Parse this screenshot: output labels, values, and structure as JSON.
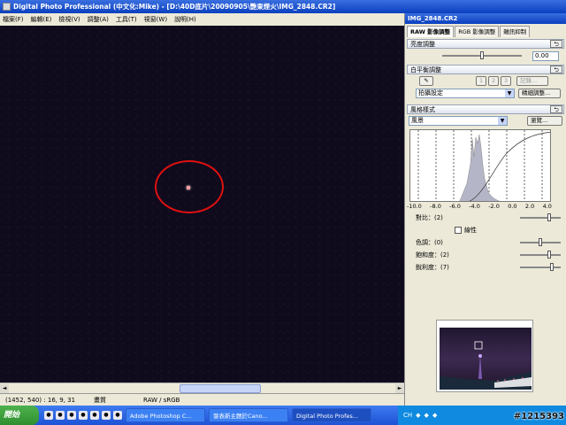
{
  "window": {
    "title": "Digital Photo Professional (中文化:Mike) - [D:\\40D底片\\20090905\\艷東煙火\\IMG_2848.CR2]"
  },
  "menu": [
    "檔案(F)",
    "編輯(E)",
    "檢視(V)",
    "調整(A)",
    "工具(T)",
    "視窗(W)",
    "說明(H)"
  ],
  "status": {
    "coords": "(1452, 540) : 16, 9, 31",
    "quality": "畫質",
    "format": "RAW / sRGB"
  },
  "panel": {
    "title": "IMG_2848.CR2",
    "tabs": [
      "RAW 影像調整",
      "RGB 影像調整",
      "雜訊抑制"
    ],
    "brightness": {
      "header": "亮度調整",
      "value": "0.00",
      "level": 0.5
    },
    "white_balance": {
      "header": "白平衡調整",
      "presets": [
        "1",
        "2",
        "3"
      ],
      "register_label": "記錄...",
      "mode": "拍攝設定",
      "fine_tune_label": "精細調整..."
    },
    "picture_style": {
      "header": "風格樣式",
      "style": "風景",
      "browse_label": "瀏覽...",
      "histogram_ticks": [
        "-10.0",
        "-8.0",
        "-6.0",
        "-4.0",
        "-2.0",
        "0.0",
        "2.0",
        "4.0"
      ],
      "contrast_label": "對比：(2)",
      "contrast_level": 0.71,
      "linear_label": "線性",
      "tone_label": "色調：(0)",
      "tone_level": 0.5,
      "saturation_label": "飽和度：(2)",
      "saturation_level": 0.71,
      "sharpness_label": "銳利度：(7)",
      "sharpness_level": 0.78
    },
    "reset_icon": "undo-arrow-icon"
  },
  "taskbar": {
    "start": "開始",
    "tasks": [
      "Adobe Photoshop C...",
      "發表新主題於Cano...",
      "Digital Photo Profes..."
    ],
    "tray_lang": "CH"
  },
  "watermark": "#1215393",
  "colors": {
    "title_blue": "#0a3fbf",
    "circle_red": "#e01010",
    "canvas_bg": "#0f0b1d"
  }
}
